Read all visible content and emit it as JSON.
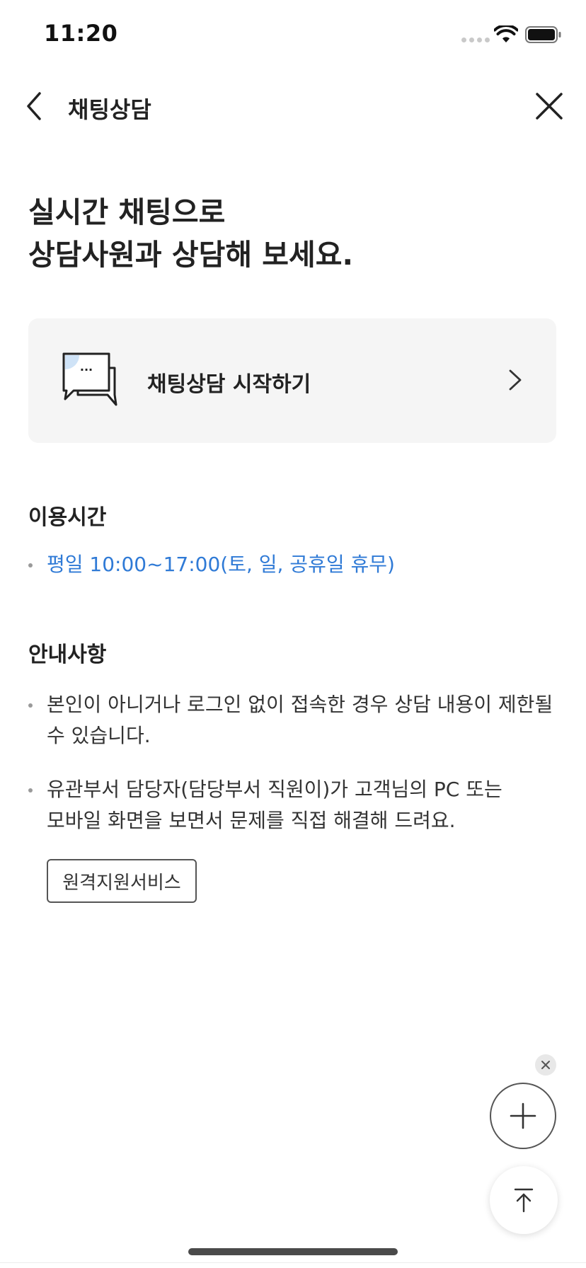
{
  "status_bar": {
    "time": "11:20"
  },
  "header": {
    "title": "채팅상담"
  },
  "headline": {
    "line1": "실시간 채팅으로",
    "line2": "상담사원과 상담해 보세요."
  },
  "chat_card": {
    "label": "채팅상담 시작하기",
    "bubble_text": "..."
  },
  "hours_section": {
    "title": "이용시간",
    "items": [
      "평일 10:00~17:00(토, 일, 공휴일 휴무)"
    ]
  },
  "notice_section": {
    "title": "안내사항",
    "items": [
      {
        "line1": "본인이 아니거나 로그인 없이 접속한 경우 상담 내용이 제한될",
        "line2": "수 있습니다."
      },
      {
        "line1": "유관부서 담당자(담당부서 직원이)가 고객님의 PC 또는",
        "line2": "모바일 화면을 보면서 문제를 직접 해결해 드려요."
      }
    ],
    "remote_button_label": "원격지원서비스"
  },
  "colors": {
    "accent_blue": "#2f7ad6",
    "card_background": "#f5f5f5",
    "bubble_highlight": "#cfe3f7"
  }
}
